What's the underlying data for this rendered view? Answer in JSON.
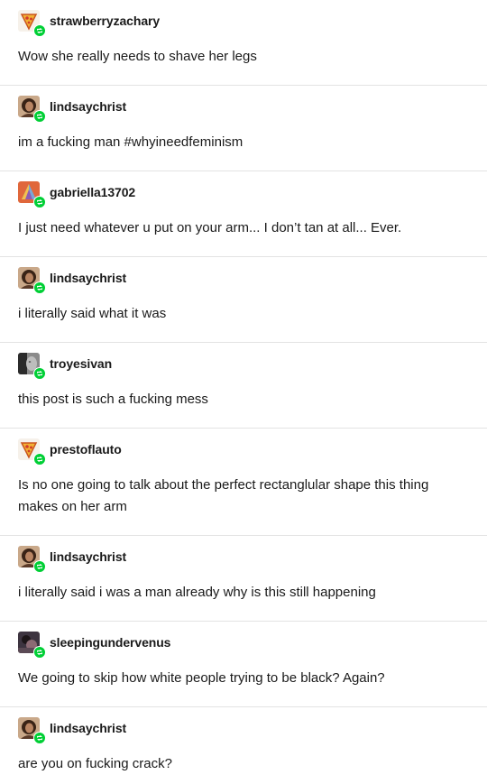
{
  "posts": [
    {
      "username": "strawberryzachary",
      "text": "Wow she really needs to shave her legs",
      "avatar_icon": "pizza-avatar-icon"
    },
    {
      "username": "lindsaychrist",
      "text": "im a fucking man #whyineedfeminism",
      "avatar_icon": "portrait-avatar-icon"
    },
    {
      "username": "gabriella13702",
      "text": "I just need whatever u put on your arm... I don’t tan at all... Ever.",
      "avatar_icon": "colorful-avatar-icon"
    },
    {
      "username": "lindsaychrist",
      "text": "i literally said what it was",
      "avatar_icon": "portrait-avatar-icon"
    },
    {
      "username": "troyesivan",
      "text": "this post is such a fucking mess",
      "avatar_icon": "grayscale-avatar-icon"
    },
    {
      "username": "prestoflauto",
      "text": "Is no one going to talk about the perfect rectanglular shape this thing makes on her arm",
      "avatar_icon": "pizza-avatar-icon"
    },
    {
      "username": "lindsaychrist",
      "text": "i literally said i was a man already why is this still happening",
      "avatar_icon": "portrait-avatar-icon"
    },
    {
      "username": "sleepingundervenus",
      "text": "We going to skip how white people trying to be black? Again?",
      "avatar_icon": "dark-avatar-icon"
    },
    {
      "username": "lindsaychrist",
      "text": "are you on fucking crack?",
      "avatar_icon": "portrait-avatar-icon"
    }
  ],
  "colors": {
    "reblog_badge": "#00cf35",
    "divider": "#e3e3e3",
    "text": "#1a1a1a"
  }
}
